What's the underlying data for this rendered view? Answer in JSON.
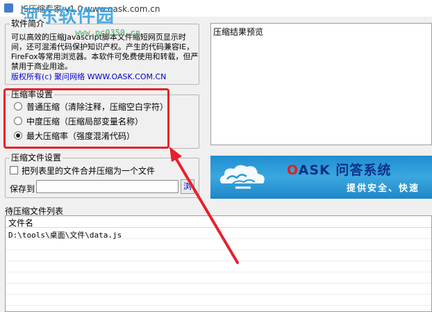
{
  "window": {
    "title": "JS压缩专家 v1.0 www.oask.com.cn",
    "watermark": "河东软件园",
    "watermark_sub": "www.pc0359.cn"
  },
  "intro": {
    "title": "软件简介",
    "text": "可以高效的压缩Javascript脚本文件缩短网页显示时间，还可混淆代码保护知识产权。产生的代码兼容IE，FireFox等常用浏览器。本软件可免费使用和转载，但严禁用于商业用途。",
    "copyright": "版权所有(c) 聚问网络 WWW.OASK.COM.CN"
  },
  "compression_rate": {
    "title": "压缩率设置",
    "options": [
      {
        "label": "普通压缩（清除注释，压缩空白字符）",
        "checked": false
      },
      {
        "label": "中度压缩（压缩局部变量名称）",
        "checked": false
      },
      {
        "label": "最大压缩率（强度混淆代码）",
        "checked": true
      }
    ]
  },
  "file_settings": {
    "title": "压缩文件设置",
    "merge_label": "把列表里的文件合并压缩为一个文件",
    "merge_checked": false,
    "save_label": "保存到",
    "save_value": "",
    "browse_label": "浏"
  },
  "preview": {
    "title": "压缩结果预览"
  },
  "banner": {
    "brand_o": "O",
    "brand_rest": "ASK 问答系统",
    "tagline": "提供安全、快速"
  },
  "file_list": {
    "title": "待压缩文件列表",
    "column": "文件名",
    "rows": [
      "D:\\tools\\桌面\\文件\\data.js"
    ]
  },
  "colors": {
    "highlight": "#e8202a",
    "banner": "#2b9ad8",
    "link": "#0000cc"
  }
}
